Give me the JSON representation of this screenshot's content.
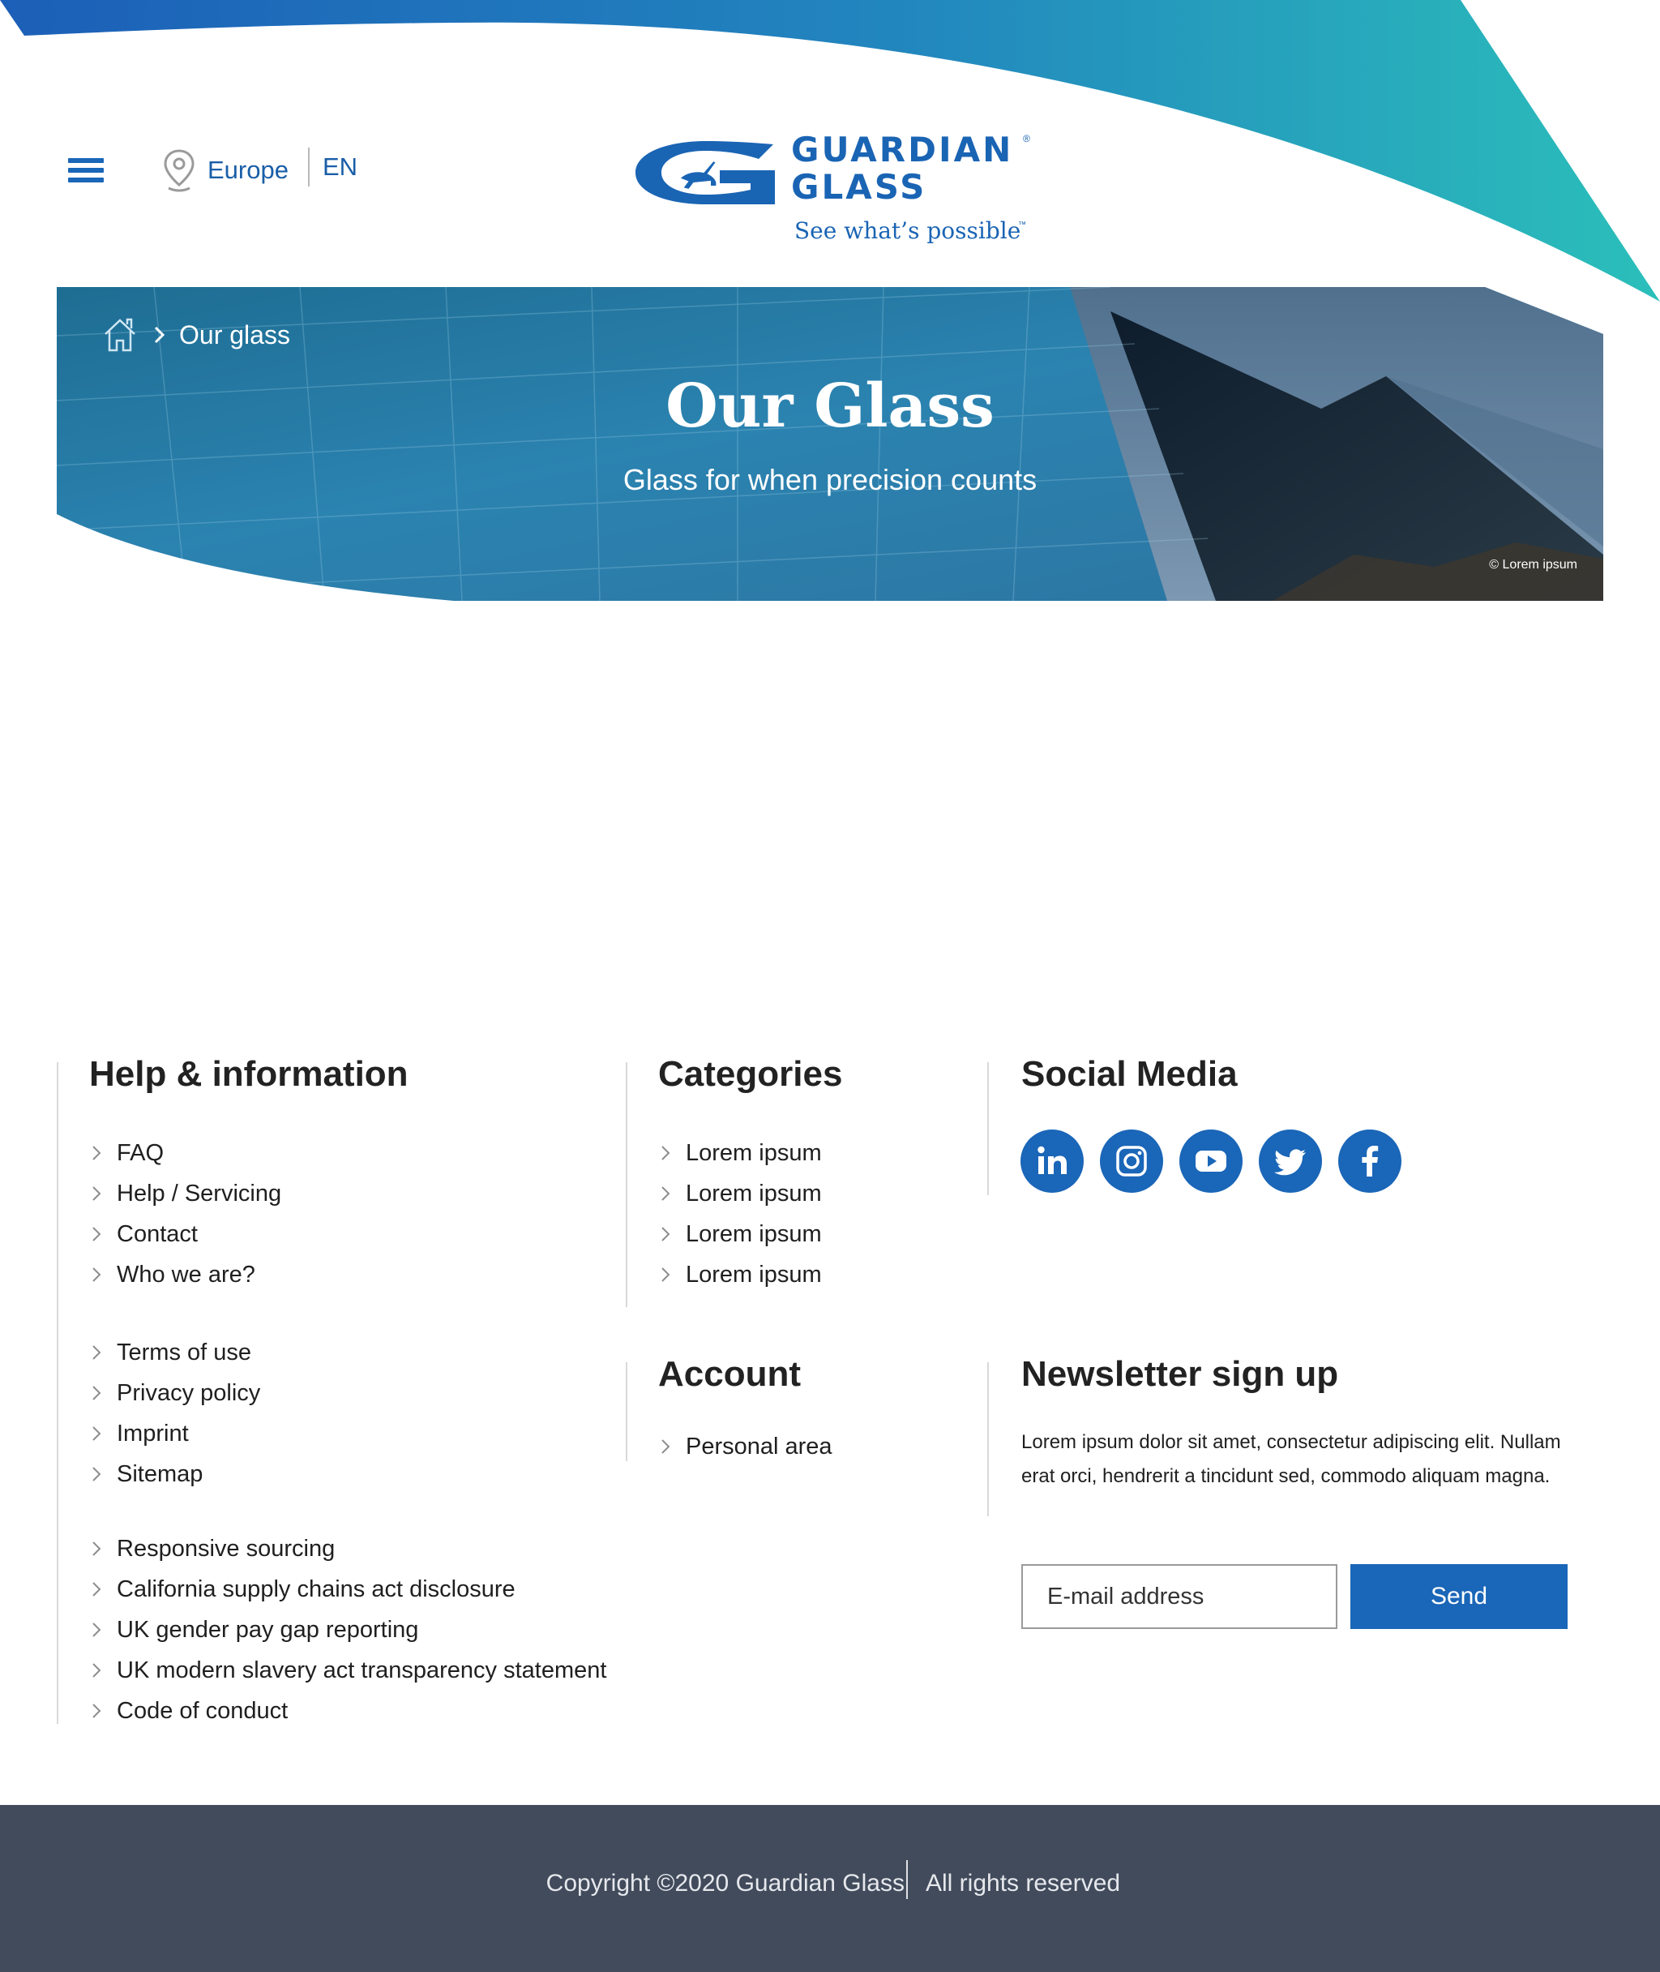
{
  "header": {
    "menu_icon": "hamburger-menu-icon",
    "region_icon": "location-pin-icon",
    "region_label": "Europe",
    "language": "EN",
    "logo": {
      "line1": "GUARDIAN",
      "line2": "GLASS",
      "registered": "®",
      "tagline": "See what’s possible",
      "trademark": "™"
    },
    "colors": {
      "brand_blue": "#1a66b8",
      "swoosh_start": "#1c5fb8",
      "swoosh_end": "#2bbfba"
    }
  },
  "hero": {
    "breadcrumb": {
      "home_icon": "home-icon",
      "separator_icon": "chevron-right-icon",
      "current": "Our glass"
    },
    "title": "Our Glass",
    "subtitle": "Glass for when precision counts",
    "photo_credit": "© Lorem ipsum"
  },
  "footer": {
    "help": {
      "heading": "Help & information",
      "group1": [
        "FAQ",
        "Help / Servicing",
        "Contact",
        "Who we are?"
      ],
      "group2": [
        "Terms of use",
        "Privacy policy",
        "Imprint",
        "Sitemap"
      ],
      "group3": [
        "Responsive sourcing",
        "California supply chains act disclosure",
        "UK gender pay gap reporting",
        "UK modern slavery act transparency statement",
        "Code of conduct"
      ]
    },
    "categories": {
      "heading": "Categories",
      "items": [
        "Lorem ipsum",
        "Lorem ipsum",
        "Lorem ipsum",
        "Lorem ipsum"
      ]
    },
    "account": {
      "heading": "Account",
      "items": [
        "Personal area"
      ]
    },
    "social": {
      "heading": "Social Media",
      "icons": [
        "linkedin-icon",
        "instagram-icon",
        "youtube-icon",
        "twitter-icon",
        "facebook-icon"
      ]
    },
    "newsletter": {
      "heading": "Newsletter sign up",
      "text": "Lorem ipsum dolor sit amet, consectetur adipiscing elit. Nullam erat orci, hendrerit a tincidunt sed, commodo aliquam magna.",
      "email_placeholder": "E-mail address",
      "send_label": "Send"
    }
  },
  "bottom_bar": {
    "copyright": "Copyright ©2020 Guardian Glass",
    "rights": "All rights reserved",
    "background": "#414b5c"
  }
}
